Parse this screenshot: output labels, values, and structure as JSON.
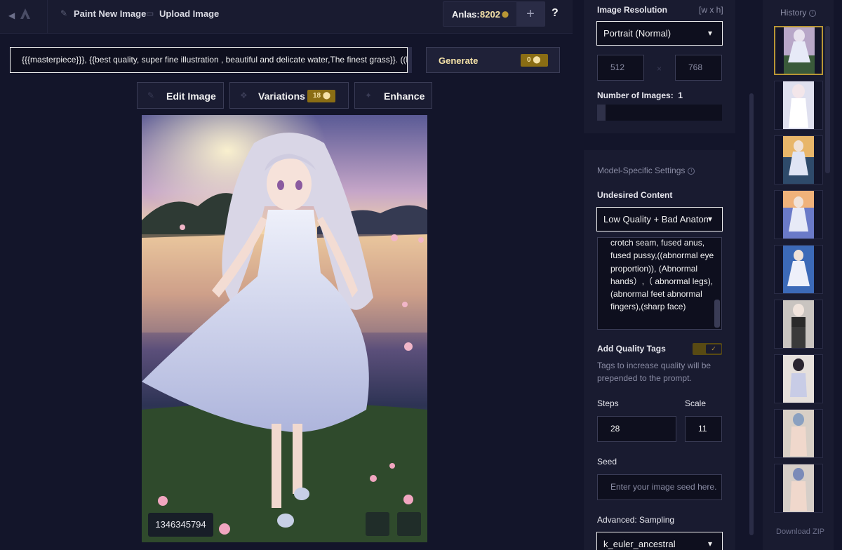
{
  "topbar": {
    "paint_new_image": "Paint New Image",
    "upload_image": "Upload Image",
    "anlas_label": "Anlas:",
    "anlas_amount": "8202",
    "add_anlas": "+",
    "help": "?"
  },
  "prompt": {
    "value": "{{{masterpiece}}}, {{best quality, super fine illustration , beautiful and delicate water,The finest grass}}. ((be"
  },
  "generate": {
    "label": "Generate",
    "cost": "0"
  },
  "actions": {
    "edit_image": "Edit Image",
    "variations": "Variations",
    "variations_cost": "18",
    "enhance": "Enhance"
  },
  "image": {
    "seed": "1346345794"
  },
  "settings": {
    "resolution_label": "Image Resolution",
    "resolution_hint": "[w x h]",
    "resolution_value": "Portrait (Normal)",
    "width": "512",
    "height": "768",
    "num_images_label": "Number of Images:",
    "num_images_value": "1",
    "model_settings_label": "Model-Specific Settings",
    "undesired_label": "Undesired Content",
    "undesired_preset": "Low Quality + Bad Anatomy",
    "undesired_text": "crotch seam, fused anus, fused pussy,((abnormal eye proportion)), (Abnormal hands）,（ abnormal legs), (abnormal feet abnormal fingers),(sharp face)",
    "quality_tags_label": "Add Quality Tags",
    "quality_tags_desc": "Tags to increase quality will be prepended to the prompt.",
    "steps_label": "Steps",
    "steps_value": "28",
    "scale_label": "Scale",
    "scale_value": "11",
    "seed_label": "Seed",
    "seed_placeholder": "Enter your image seed here.",
    "sampling_label": "Advanced: Sampling",
    "sampling_value": "k_euler_ancestral"
  },
  "history": {
    "title": "History",
    "download_zip": "Download ZIP",
    "thumbnail_count": 9
  },
  "colors": {
    "background": "#13152a",
    "panel": "#191b30",
    "accent_gold": "#b89635",
    "gold_text": "#f5e2a8"
  }
}
